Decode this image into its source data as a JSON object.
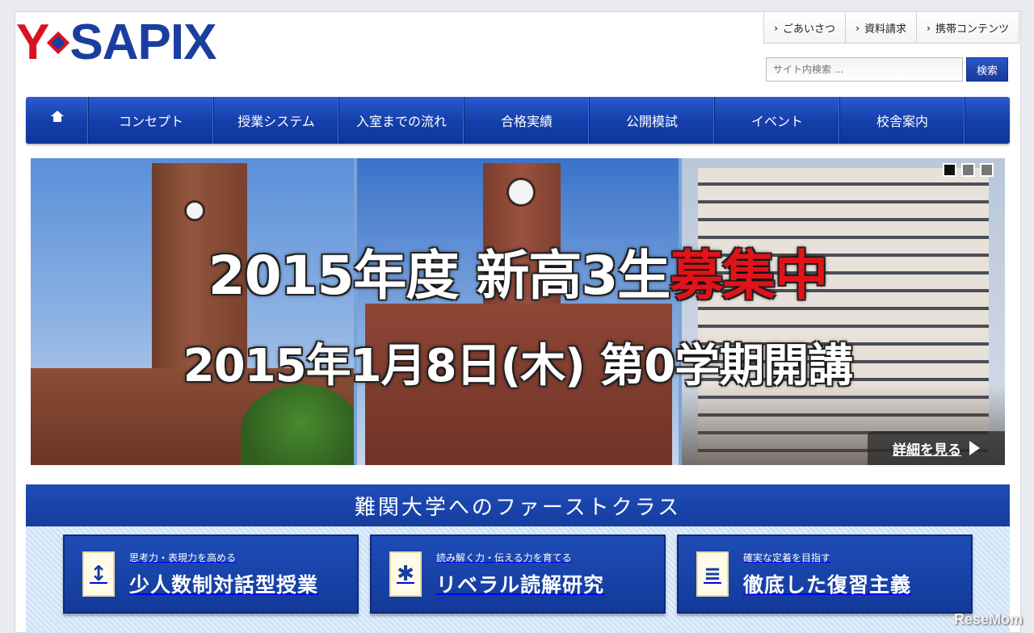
{
  "header": {
    "logo_prefix": "Y",
    "logo_main": "SAPIX",
    "util_links": [
      "ごあいさつ",
      "資料請求",
      "携帯コンテンツ"
    ],
    "search_placeholder": "サイト内検索 ...",
    "search_button": "検索"
  },
  "nav": {
    "home_icon": "home-icon",
    "items": [
      "コンセプト",
      "授業システム",
      "入室までの流れ",
      "合格実績",
      "公開模試",
      "イベント",
      "校舎案内"
    ]
  },
  "hero": {
    "line1_main": "2015年度 新高3生",
    "line1_accent": "募集中",
    "line2": "2015年1月8日(木) 第0学期開講",
    "more_label": "詳細を見る",
    "slide_count": 3,
    "active_slide": 1,
    "accent_color": "#e0131a"
  },
  "features": {
    "title": "難関大学へのファーストクラス",
    "items": [
      {
        "sub": "思考力・表現力を高める",
        "main": "少人数制対話型授業",
        "icon": "arrows-vertical-icon"
      },
      {
        "sub": "読み解く力・伝える力を育てる",
        "main": "リベラル読解研究",
        "icon": "snowflake-icon"
      },
      {
        "sub": "確実な定着を目指す",
        "main": "徹底した復習主義",
        "icon": "stack-icon"
      }
    ]
  },
  "watermark": "ReseMom",
  "colors": {
    "brand_blue": "#1a3ea0",
    "brand_red": "#d9121f"
  }
}
